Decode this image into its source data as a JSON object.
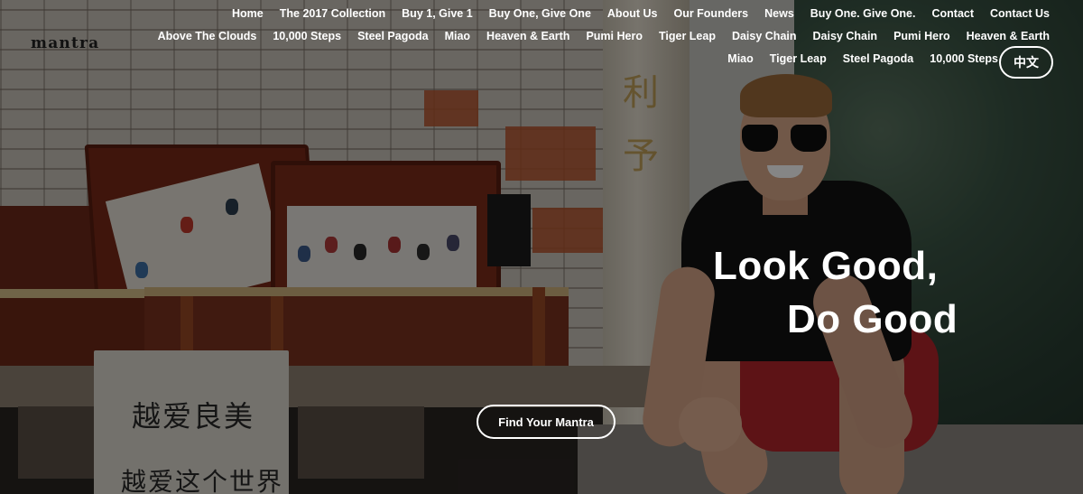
{
  "brand": {
    "logo": "mantra"
  },
  "nav": {
    "row1": [
      "Home",
      "The 2017 Collection",
      "Buy 1, Give 1",
      "Buy One, Give One",
      "About Us",
      "Our Founders",
      "News",
      "Buy One. Give One.",
      "Contact",
      "Contact Us"
    ],
    "row2": [
      "Above The Clouds",
      "10,000 Steps",
      "Steel Pagoda",
      "Miao",
      "Heaven & Earth",
      "Pumi Hero",
      "Tiger Leap",
      "Daisy Chain",
      "Daisy Chain",
      "Pumi Hero",
      "Heaven & Earth"
    ],
    "row3": [
      "Miao",
      "Tiger Leap",
      "Steel Pagoda",
      "10,000 Steps"
    ]
  },
  "language_toggle": "中文",
  "hero": {
    "headline_line1": "Look Good,",
    "headline_line2": "Do Good",
    "cta_label": "Find Your Mantra"
  },
  "scene": {
    "tote_text_line1": "越爱良美",
    "tote_text_line2": "越爱这个世界"
  },
  "colors": {
    "text": "#ffffff",
    "overlay": "rgba(0,0,0,0.48)",
    "shorts": "#b2252b",
    "trunk": "#7a2a17"
  }
}
